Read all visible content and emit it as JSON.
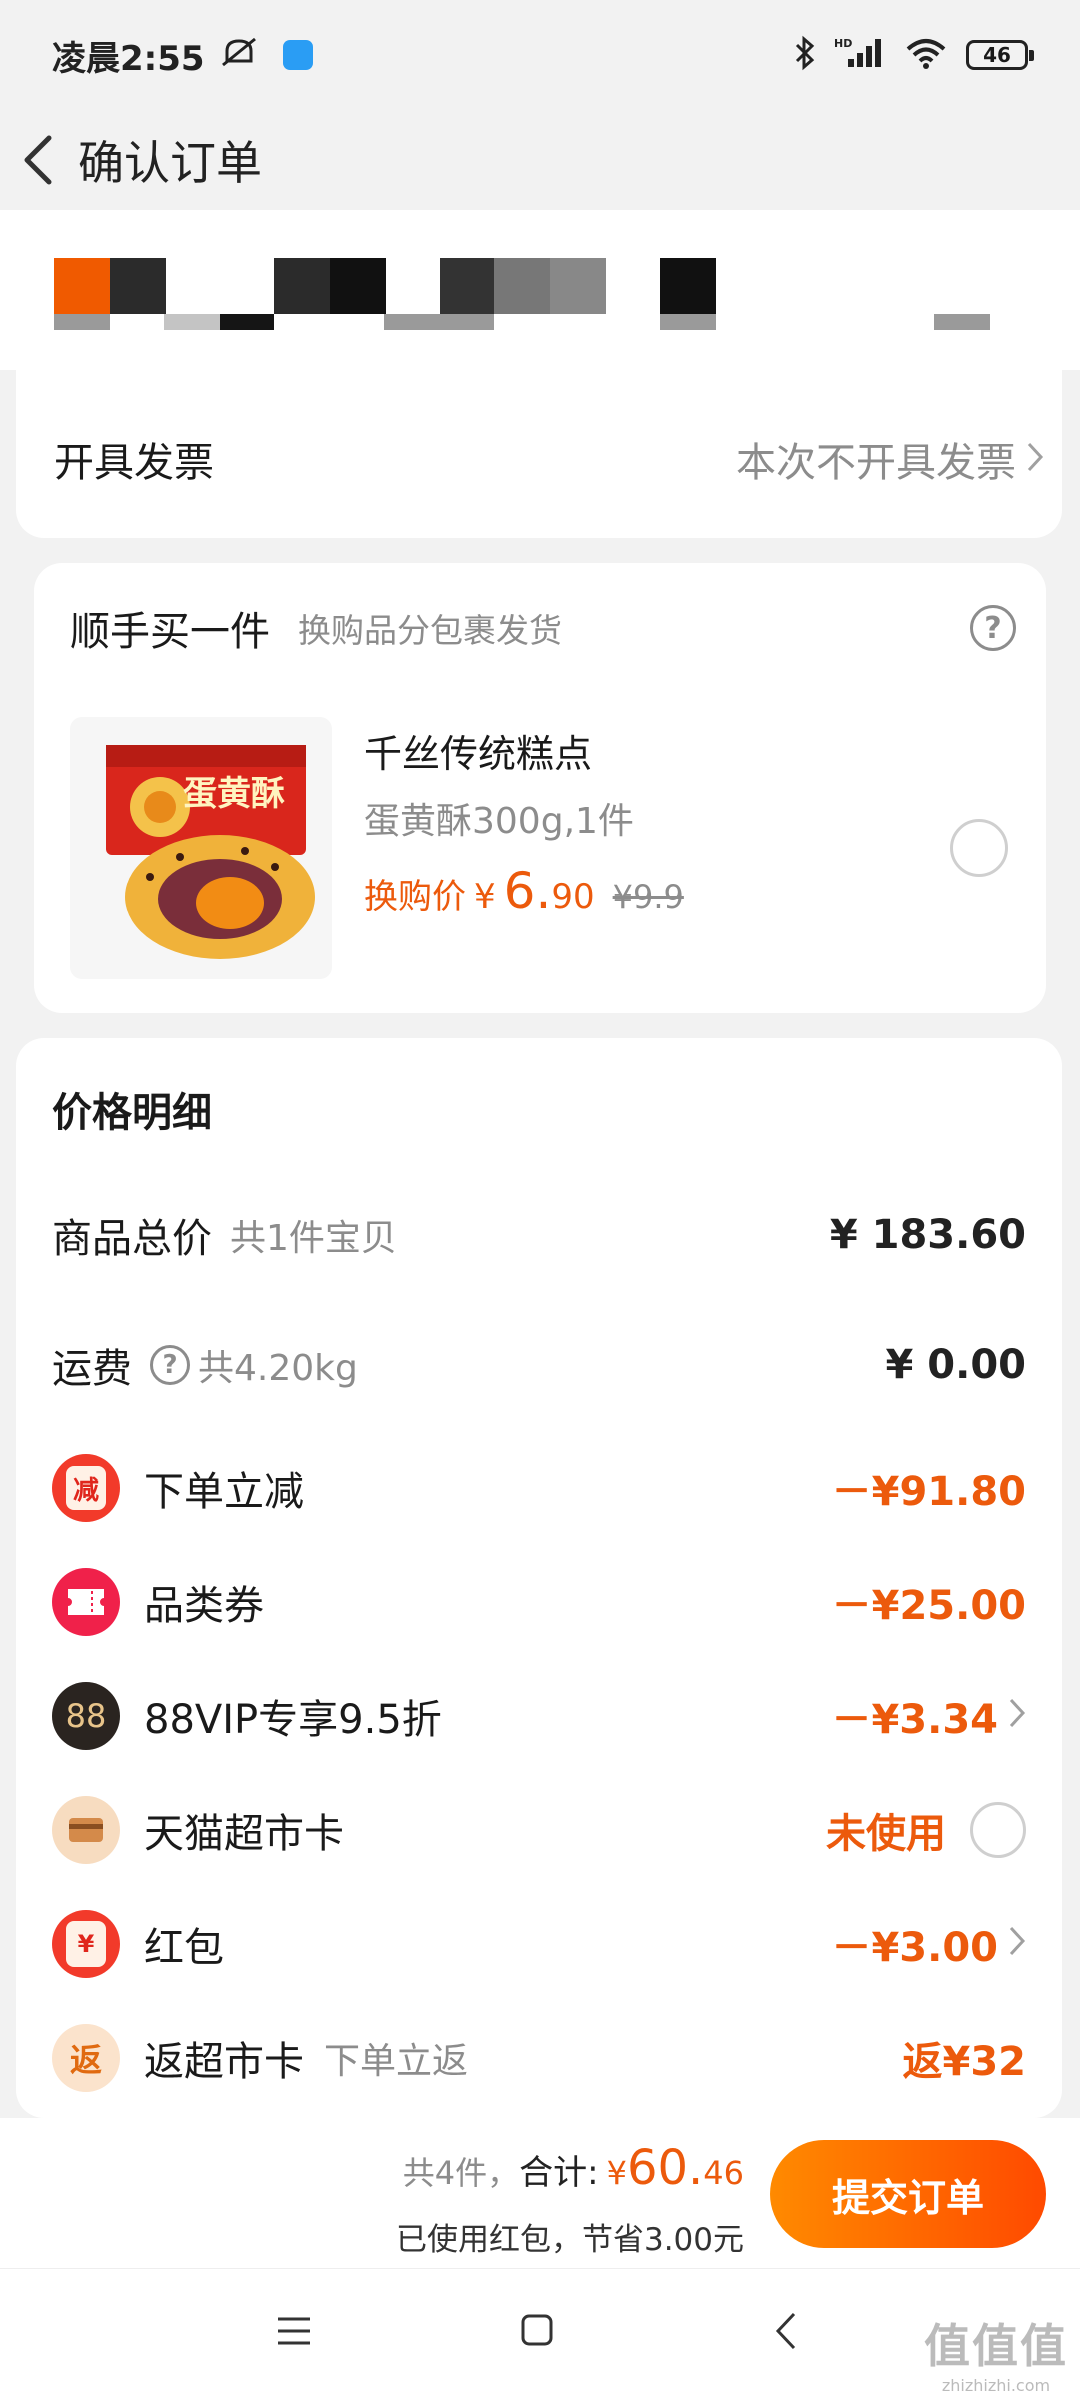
{
  "status_bar": {
    "time": "凌晨2:55",
    "battery": "46",
    "icons": [
      "mute-icon",
      "app-notification-icon",
      "bluetooth-icon",
      "hd-signal-icon",
      "wifi-icon",
      "battery-icon"
    ]
  },
  "header": {
    "title": "确认订单"
  },
  "invoice": {
    "label": "开具发票",
    "value": "本次不开具发票"
  },
  "addon": {
    "title": "顺手买一件",
    "subtitle": "换购品分包裹发货",
    "product_name": "千丝传统糕点",
    "product_spec": "蛋黄酥300g,1件",
    "price_label": "换购价",
    "price_symbol": "¥",
    "price_int": "6.",
    "price_dec": "90",
    "original_price": "¥9.9",
    "image_text": "蛋黄酥"
  },
  "price_detail": {
    "title": "价格明细",
    "goods_total_label": "商品总价",
    "goods_total_note": "共1件宝贝",
    "goods_total_value": "¥ 183.60",
    "shipping_label": "运费",
    "shipping_note": "共4.20kg",
    "shipping_value": "¥ 0.00",
    "items": [
      {
        "label": "下单立减",
        "value": "－¥91.80",
        "icon_text": "减"
      },
      {
        "label": "品类券",
        "value": "－¥25.00"
      },
      {
        "label": "88VIP专享9.5折",
        "value": "－¥3.34",
        "icon_text": "88"
      },
      {
        "label": "天猫超市卡",
        "value": "未使用"
      },
      {
        "label": "红包",
        "value": "－¥3.00",
        "icon_text": "¥"
      },
      {
        "label": "返超市卡",
        "note": "下单立返",
        "value": "返¥32",
        "icon_text": "返"
      }
    ]
  },
  "footer": {
    "count": "共4件，",
    "total_label": "合计:",
    "total_symbol": "¥",
    "total_int": "60.",
    "total_dec": "46",
    "savings": "已使用红包，节省3.00元",
    "submit": "提交订单"
  },
  "watermark": {
    "main": "值值值",
    "sub": "zhizhizhi.com"
  },
  "colors": {
    "accent": "#ec5a0c",
    "submit_start": "#ff8a00",
    "submit_end": "#ff4a00"
  }
}
